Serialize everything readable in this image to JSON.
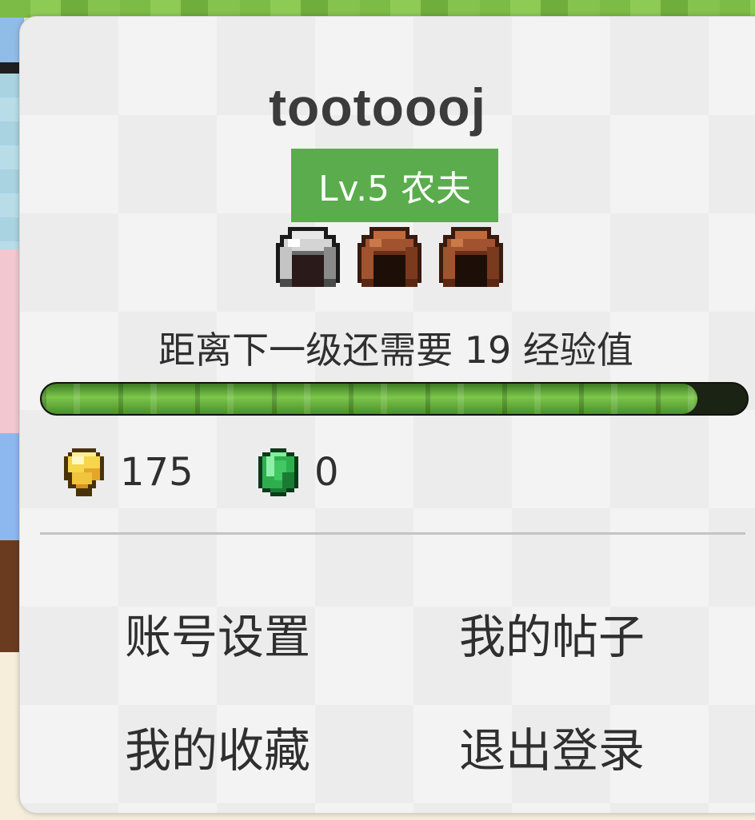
{
  "profile": {
    "username": "tootoooj",
    "level_label": "Lv.5 农夫",
    "level_color": "#5aac4c",
    "armor": [
      {
        "name": "iron-helmet-icon",
        "color": "#d8d8d8"
      },
      {
        "name": "leather-helmet-icon",
        "color": "#a1532f"
      },
      {
        "name": "leather-helmet-icon",
        "color": "#a1532f"
      }
    ]
  },
  "experience": {
    "text": "距离下一级还需要 19 经验值",
    "progress_fraction": 0.93
  },
  "currency": {
    "gold": {
      "icon": "gold-nugget-icon",
      "amount": "175"
    },
    "emerald": {
      "icon": "emerald-icon",
      "amount": "0"
    }
  },
  "menu": {
    "account_settings": "账号设置",
    "my_posts": "我的帖子",
    "my_favorites": "我的收藏",
    "logout": "退出登录"
  }
}
